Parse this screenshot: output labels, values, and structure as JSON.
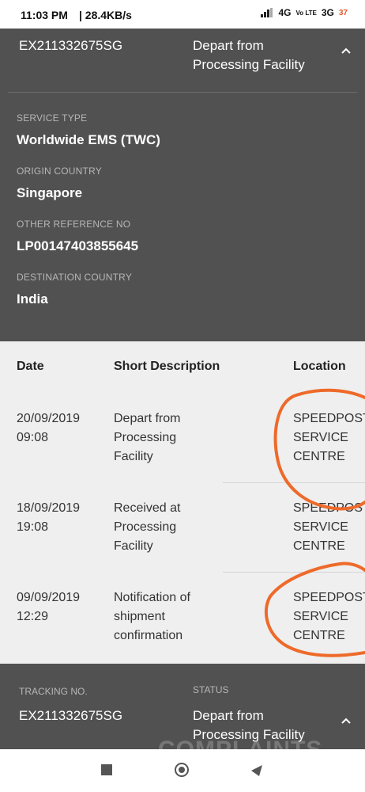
{
  "status_bar": {
    "time": "11:03 PM",
    "network_speed": "| 28.4KB/s",
    "network_4g": "4G",
    "volte": "Vo LTE",
    "network_3g": "3G",
    "battery": "37"
  },
  "top_card": {
    "tracking_number": "EX211332675SG",
    "status": "Depart from Processing Facility",
    "details": [
      {
        "label": "SERVICE TYPE",
        "value": "Worldwide EMS (TWC)"
      },
      {
        "label": "ORIGIN COUNTRY",
        "value": "Singapore"
      },
      {
        "label": "OTHER REFERENCE NO",
        "value": "LP00147403855645"
      },
      {
        "label": "DESTINATION COUNTRY",
        "value": "India"
      }
    ]
  },
  "events_table": {
    "headers": {
      "date": "Date",
      "description": "Short Description",
      "location": "Location"
    },
    "rows": [
      {
        "date": "20/09/2019",
        "time": "09:08",
        "desc1": "Depart from",
        "desc2": "Processing",
        "desc3": "Facility",
        "loc1": "SPEEDPOST",
        "loc2": "SERVICE",
        "loc3": "CENTRE"
      },
      {
        "date": "18/09/2019",
        "time": "19:08",
        "desc1": "Received at",
        "desc2": "Processing",
        "desc3": "Facility",
        "loc1": "SPEEDPOST",
        "loc2": "SERVICE",
        "loc3": "CENTRE"
      },
      {
        "date": "09/09/2019",
        "time": "12:29",
        "desc1": "Notification of",
        "desc2": "shipment",
        "desc3": "confirmation",
        "loc1": "SPEEDPOST",
        "loc2": "SERVICE",
        "loc3": "CENTRE"
      }
    ]
  },
  "bottom_card": {
    "tracking_label": "TRACKING NO.",
    "status_label": "STATUS",
    "tracking_number": "EX211332675SG",
    "status_line1": "Depart from",
    "status_line2": "Processing Facility"
  },
  "watermark": "COMPLAINTS",
  "colors": {
    "panel": "#515151",
    "table_bg": "#efefef",
    "annotation": "#ee6a2a"
  },
  "icons": [
    "signal-icon",
    "chevron-up-icon",
    "recent-apps-icon",
    "home-icon",
    "back-icon"
  ]
}
